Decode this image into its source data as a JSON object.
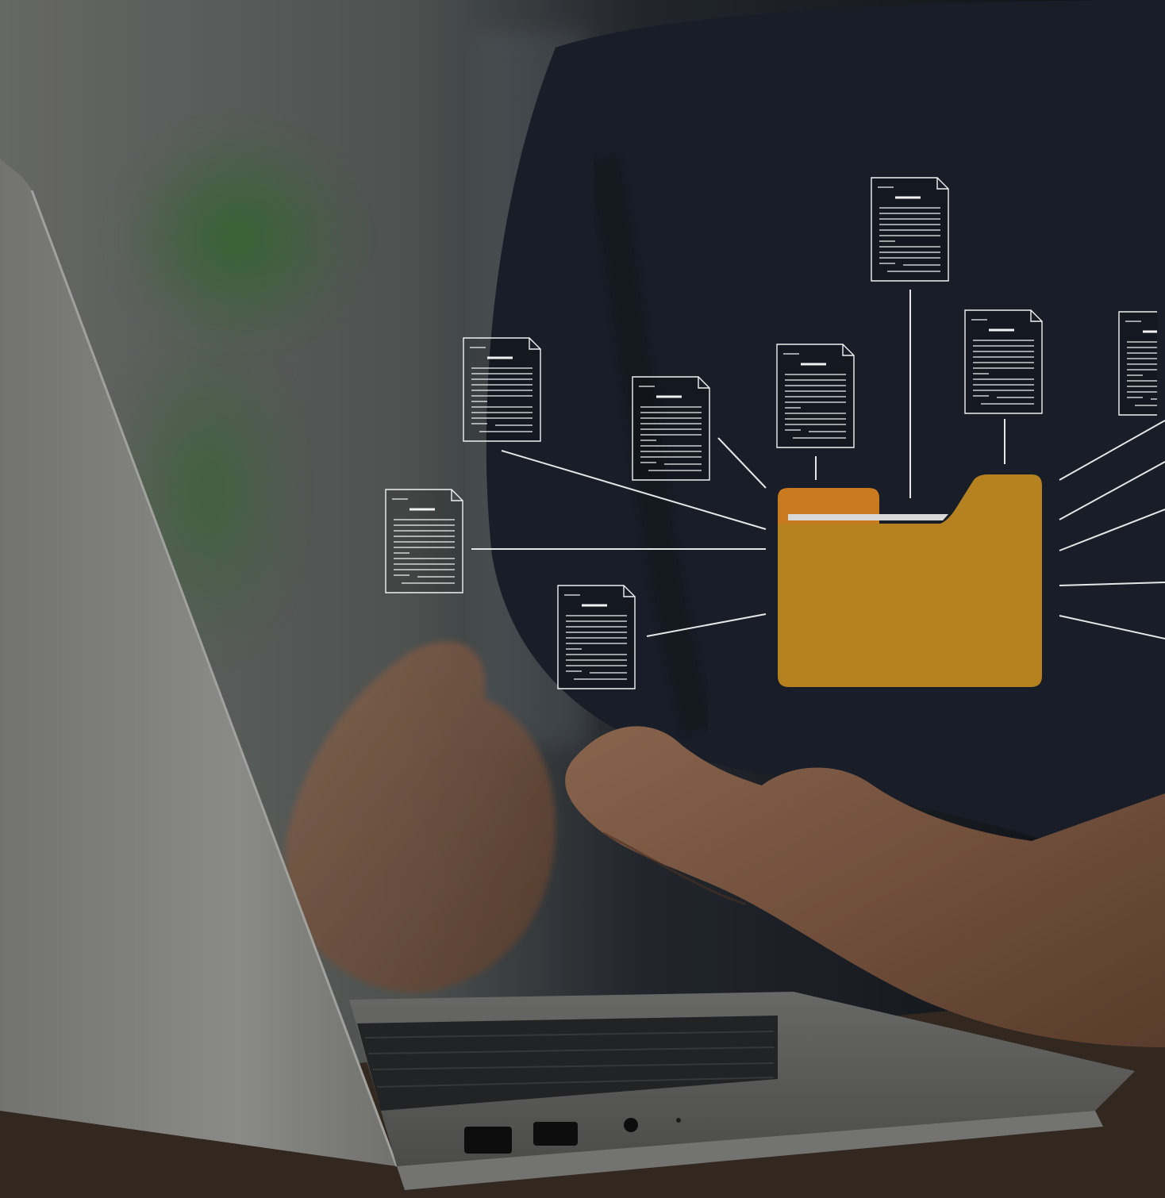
{
  "image": {
    "subject": "file-sharing-concept-photo"
  },
  "colors": {
    "folder_main": "#b5821f",
    "folder_tab": "#c97a1f",
    "folder_paper": "#d8d8d8",
    "doc_lines": "#f2f2f2",
    "connector": "#e6e6e6",
    "shade_dark": "#141a22",
    "shirt": "#1f2632",
    "skin": "#8a5e46",
    "laptop_lid": "#9a9a98",
    "desk": "#4a3a2c"
  },
  "icons": {
    "folder": "folder-icon",
    "document": "document-icon"
  },
  "documents": [
    {
      "id": "doc-top-center"
    },
    {
      "id": "doc-upper-right"
    },
    {
      "id": "doc-far-right"
    },
    {
      "id": "doc-center"
    },
    {
      "id": "doc-center-left"
    },
    {
      "id": "doc-upper-left"
    },
    {
      "id": "doc-left"
    },
    {
      "id": "doc-lower-left"
    }
  ]
}
